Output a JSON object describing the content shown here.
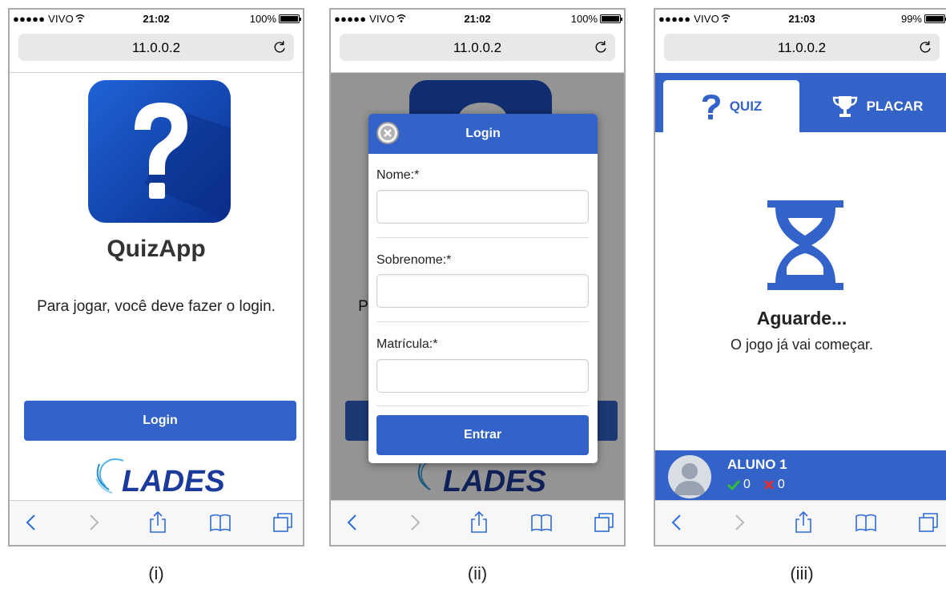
{
  "captions": [
    "(i)",
    "(ii)",
    "(iii)"
  ],
  "phones": [
    {
      "status": {
        "carrier": "●●●●● VIVO",
        "time": "21:02",
        "battery": "100%",
        "battery_level": 1.0
      },
      "url": "11.0.0.2"
    },
    {
      "status": {
        "carrier": "●●●●● VIVO",
        "time": "21:02",
        "battery": "100%",
        "battery_level": 1.0
      },
      "url": "11.0.0.2"
    },
    {
      "status": {
        "carrier": "●●●●● VIVO",
        "time": "21:03",
        "battery": "99%",
        "battery_level": 0.99
      },
      "url": "11.0.0.2"
    }
  ],
  "login_screen": {
    "app_name": "QuizApp",
    "message": "Para jogar, você deve fazer o login.",
    "login_button": "Login",
    "logo_text": "LADES"
  },
  "login_modal": {
    "title": "Login",
    "fields": [
      {
        "label": "Nome:*",
        "value": ""
      },
      {
        "label": "Sobrenome:*",
        "value": ""
      },
      {
        "label": "Matrícula:*",
        "value": ""
      }
    ],
    "submit": "Entrar"
  },
  "waiting_screen": {
    "tabs": [
      {
        "label": "QUIZ",
        "icon": "question-icon",
        "active": true
      },
      {
        "label": "PLACAR",
        "icon": "trophy-icon",
        "active": false
      }
    ],
    "title": "Aguarde...",
    "subtitle": "O jogo já vai começar.",
    "user": {
      "name": "ALUNO 1",
      "correct": "0",
      "wrong": "0"
    }
  },
  "colors": {
    "primary": "#3363c9",
    "icon_dark": "#0a2f8f",
    "correct": "#2fbf2f",
    "wrong": "#e53030"
  }
}
